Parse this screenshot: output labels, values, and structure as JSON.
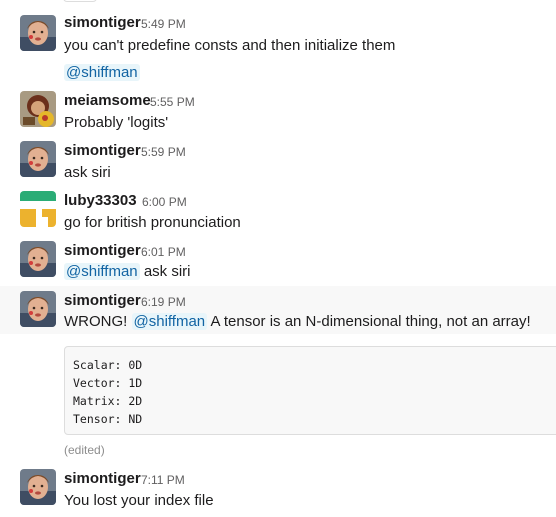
{
  "messages": [
    {
      "user": "simontiger",
      "time": "5:49 PM",
      "text": "you can't predefine consts and then initialize them"
    },
    {
      "mention": "@shiffman"
    },
    {
      "user": "meiamsome",
      "time": "5:55 PM",
      "text": "Probably 'logits'"
    },
    {
      "user": "simontiger",
      "time": "5:59 PM",
      "text": "ask siri"
    },
    {
      "user": "luby33303",
      "time": "6:00 PM",
      "text": "go for british pronunciation"
    },
    {
      "user": "simontiger",
      "time": "6:01 PM",
      "mention": "@shiffman",
      "text": " ask siri"
    },
    {
      "user": "simontiger",
      "time": "6:19 PM",
      "text_before": "WRONG! ",
      "mention": "@shiffman",
      "text_after": " A tensor is an N-dimensional thing, not an array!",
      "code_lines": [
        "Scalar: 0D",
        "Vector: 1D",
        "Matrix: 2D",
        "Tensor: ND"
      ],
      "edited": "(edited)"
    },
    {
      "user": "simontiger",
      "time": "7:11 PM",
      "text": "You lost your index file"
    }
  ],
  "colors": {
    "mention": "#1264a3",
    "mention_bg": "#e8f5fa",
    "luby_green": "#2bac76",
    "luby_yellow": "#ecb22e"
  }
}
